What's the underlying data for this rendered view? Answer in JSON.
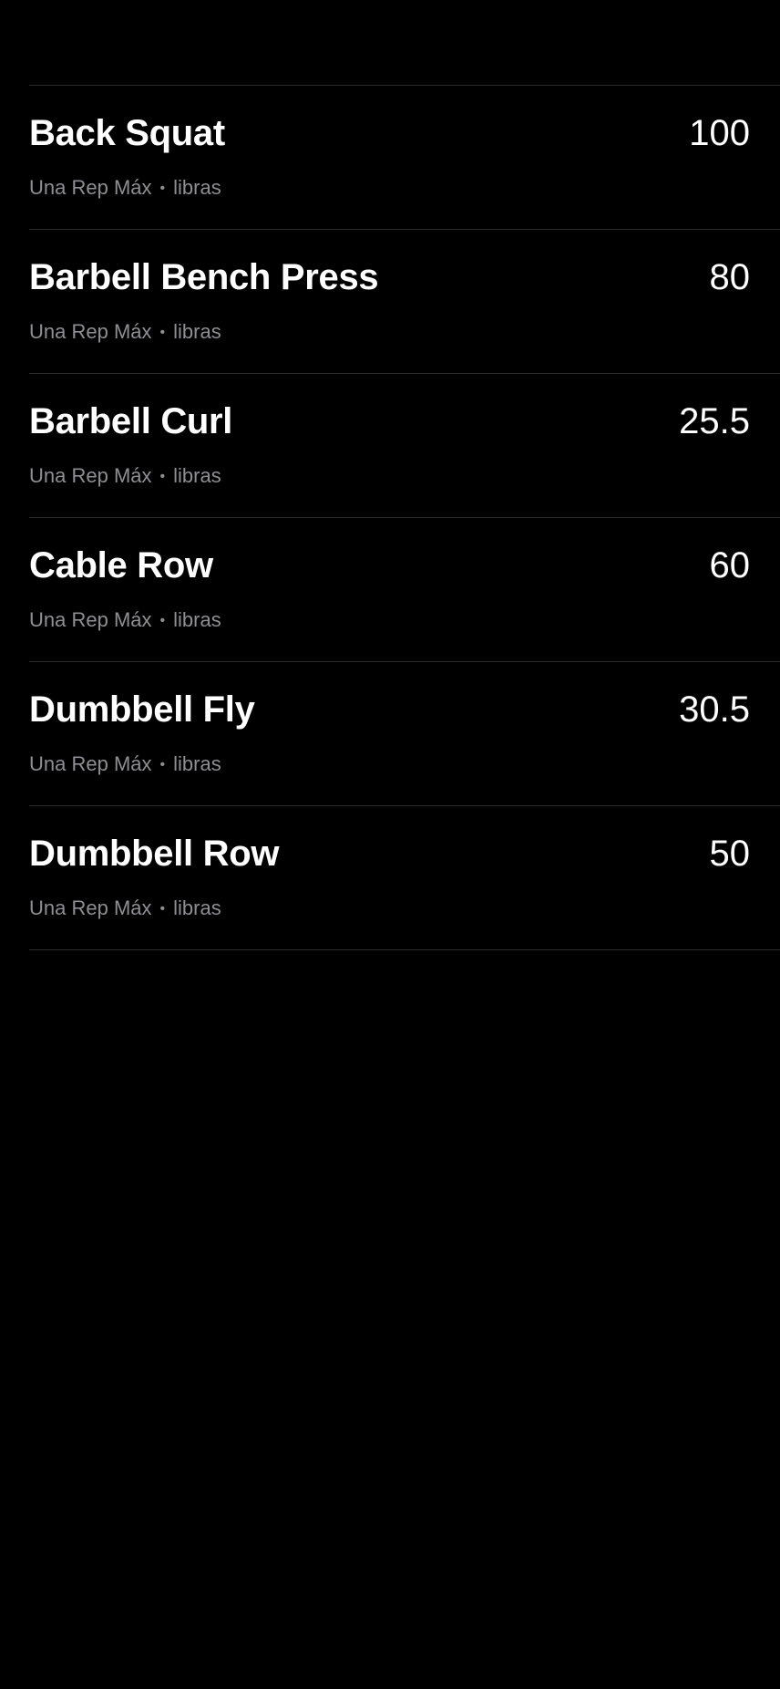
{
  "colors": {
    "background": "#000000",
    "primary_text": "#ffffff",
    "secondary_text": "#8e8e93",
    "separator": "#2b2b2d"
  },
  "exercises": [
    {
      "name": "Back Squat",
      "value": "100",
      "type": "Una Rep Máx",
      "separator": "•",
      "unit": "libras"
    },
    {
      "name": "Barbell Bench Press",
      "value": "80",
      "type": "Una Rep Máx",
      "separator": "•",
      "unit": "libras"
    },
    {
      "name": "Barbell Curl",
      "value": "25.5",
      "type": "Una Rep Máx",
      "separator": "•",
      "unit": "libras"
    },
    {
      "name": "Cable Row",
      "value": "60",
      "type": "Una Rep Máx",
      "separator": "•",
      "unit": "libras"
    },
    {
      "name": "Dumbbell Fly",
      "value": "30.5",
      "type": "Una Rep Máx",
      "separator": "•",
      "unit": "libras"
    },
    {
      "name": "Dumbbell Row",
      "value": "50",
      "type": "Una Rep Máx",
      "separator": "•",
      "unit": "libras"
    }
  ]
}
